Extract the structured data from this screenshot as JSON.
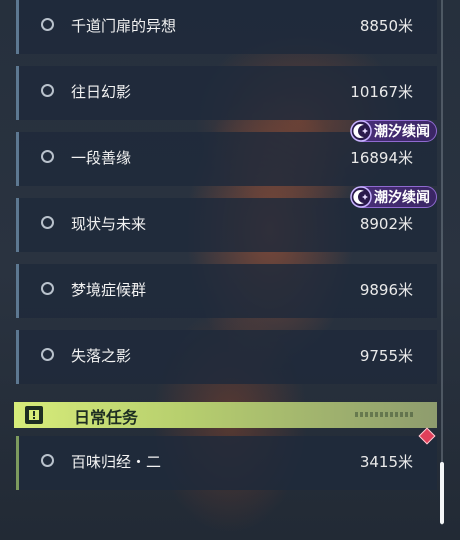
{
  "quests": [
    {
      "name": "千道门扉的异想",
      "distance": "8850米",
      "tag": ""
    },
    {
      "name": "往日幻影",
      "distance": "10167米",
      "tag": ""
    },
    {
      "name": "一段善缘",
      "distance": "16894米",
      "tag": "潮汐续闻"
    },
    {
      "name": "现状与未来",
      "distance": "8902米",
      "tag": "潮汐续闻"
    },
    {
      "name": "梦境症候群",
      "distance": "9896米",
      "tag": ""
    },
    {
      "name": "失落之影",
      "distance": "9755米",
      "tag": ""
    }
  ],
  "daily_section": {
    "title": "日常任务",
    "quests": [
      {
        "name": "百味归经・二",
        "distance": "3415米"
      }
    ]
  },
  "colors": {
    "tag_purple": "#4a2f7a",
    "daily_green": "#d7ec7a",
    "alert_red": "#e0405a"
  }
}
